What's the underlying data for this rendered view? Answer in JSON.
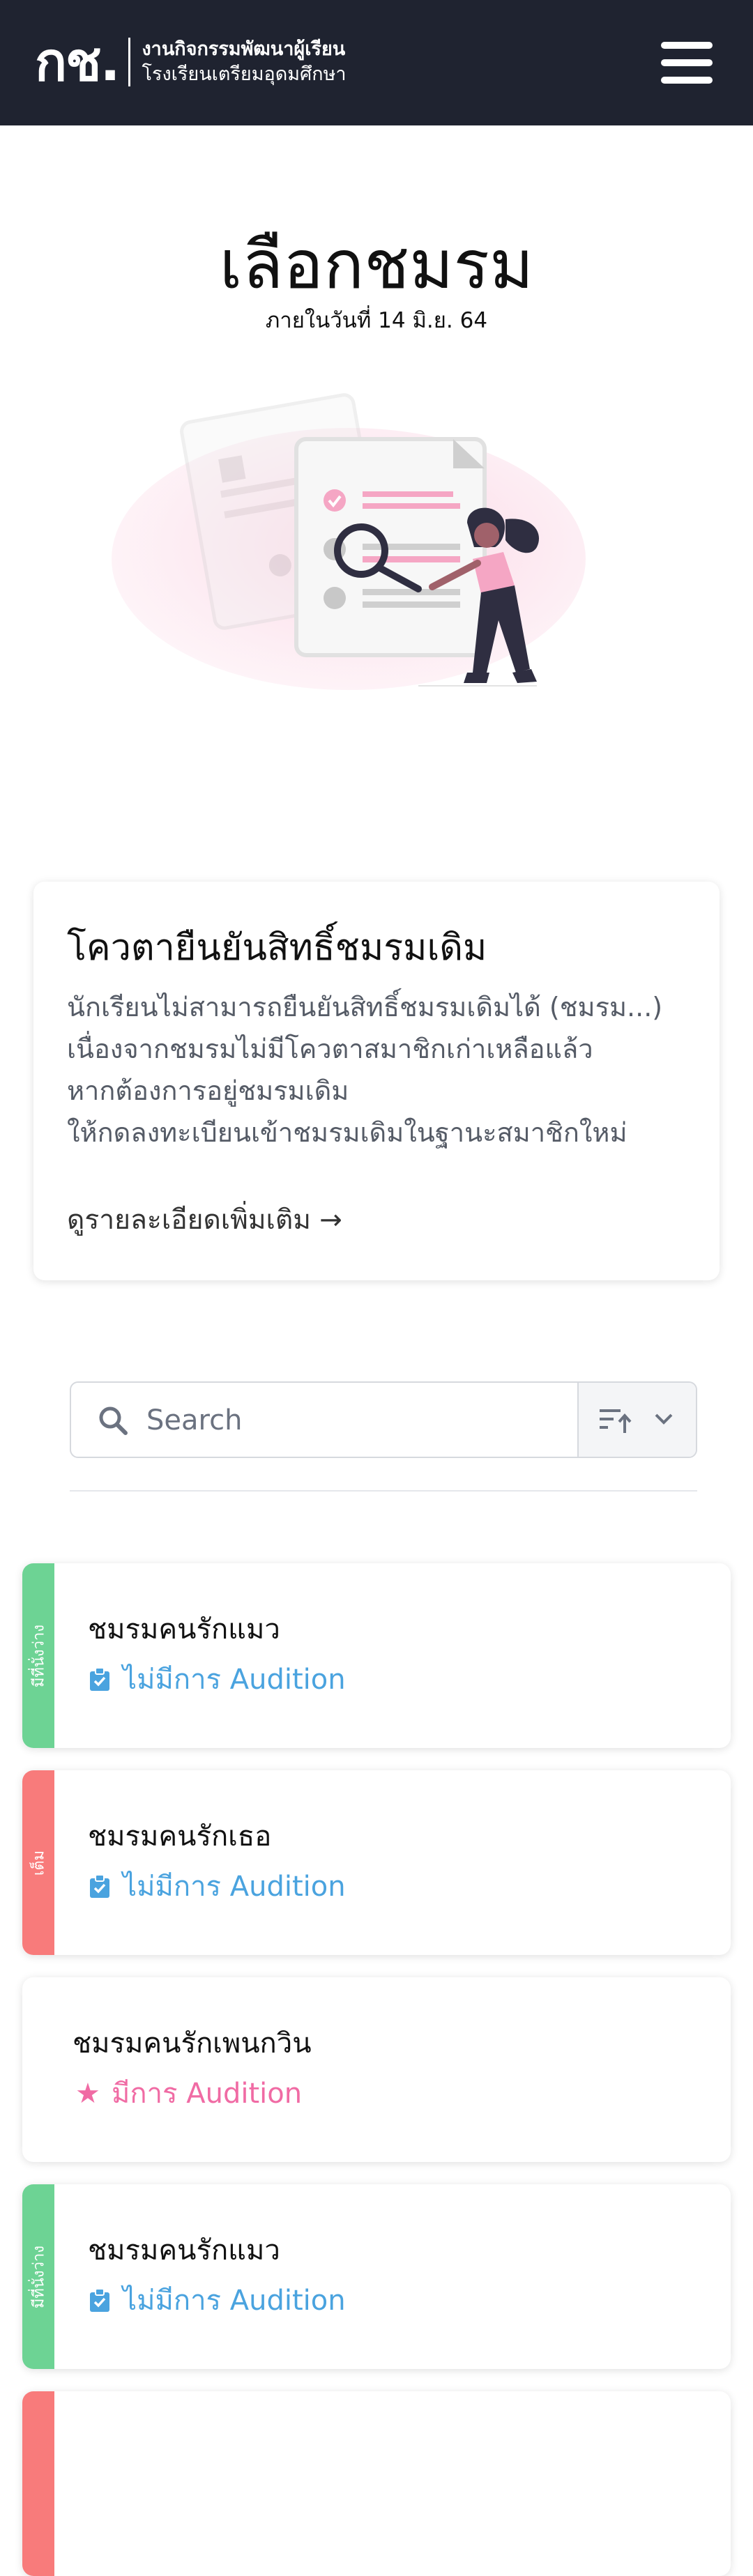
{
  "navbar": {
    "logo_mark": "กช.",
    "logo_line1": "งานกิจกรรมพัฒนาผู้เรียน",
    "logo_line2": "โรงเรียนเตรียมอุดมศึกษา",
    "menu_icon": "hamburger-icon"
  },
  "hero": {
    "title": "เลือกชมรม",
    "subtitle": "ภายในวันที่  14 มิ.ย. 64"
  },
  "quota": {
    "title": "โควตายืนยันสิทธิ์ชมรมเดิม",
    "body": [
      "นักเรียนไม่สามารถยืนยันสิทธิ์ชมรมเดิมได้ (ชมรม...)",
      "เนื่องจากชมรมไม่มีโควตาสมาชิกเก่าเหลือแล้ว",
      "หากต้องการอยู่ชมรมเดิม",
      "ให้กดลงทะเบียนเข้าชมรมเดิมในฐานะสมาชิกใหม่"
    ],
    "link": "ดูรายละเอียดเพิ่มเติม →"
  },
  "search": {
    "placeholder": "Search",
    "search_icon": "search-icon",
    "sort_icon": "sort-ascending-icon",
    "dropdown_icon": "chevron-down-icon"
  },
  "clubs": [
    {
      "name": "ชมรมคนรักแมว",
      "status": "มีที่นั่งว่าง",
      "status_color": "#6dd394",
      "audition": "ไม่มีการ Audition",
      "audition_icon": "clipboard-check-icon"
    },
    {
      "name": "ชมรมคนรักเธอ",
      "status": "เต็ม",
      "status_color": "#f87b7b",
      "audition": "ไม่มีการ Audition",
      "audition_icon": "clipboard-check-icon"
    },
    {
      "name": "ชมรมคนรักเพนกวิน",
      "status": "",
      "status_color": "",
      "audition": "มีการ Audition",
      "audition_icon": "star-icon"
    },
    {
      "name": "ชมรมคนรักแมว",
      "status": "มีที่นั่งว่าง",
      "status_color": "#6dd394",
      "audition": "ไม่มีการ Audition",
      "audition_icon": "clipboard-check-icon"
    },
    {
      "name": "",
      "status": "",
      "status_color": "#f87b7b",
      "audition": "",
      "audition_icon": ""
    }
  ],
  "colors": {
    "navbar": "#1f2330",
    "no_audition": "#4aa3df",
    "audition": "#f06ba4",
    "available": "#6dd394",
    "full": "#f87b7b"
  }
}
